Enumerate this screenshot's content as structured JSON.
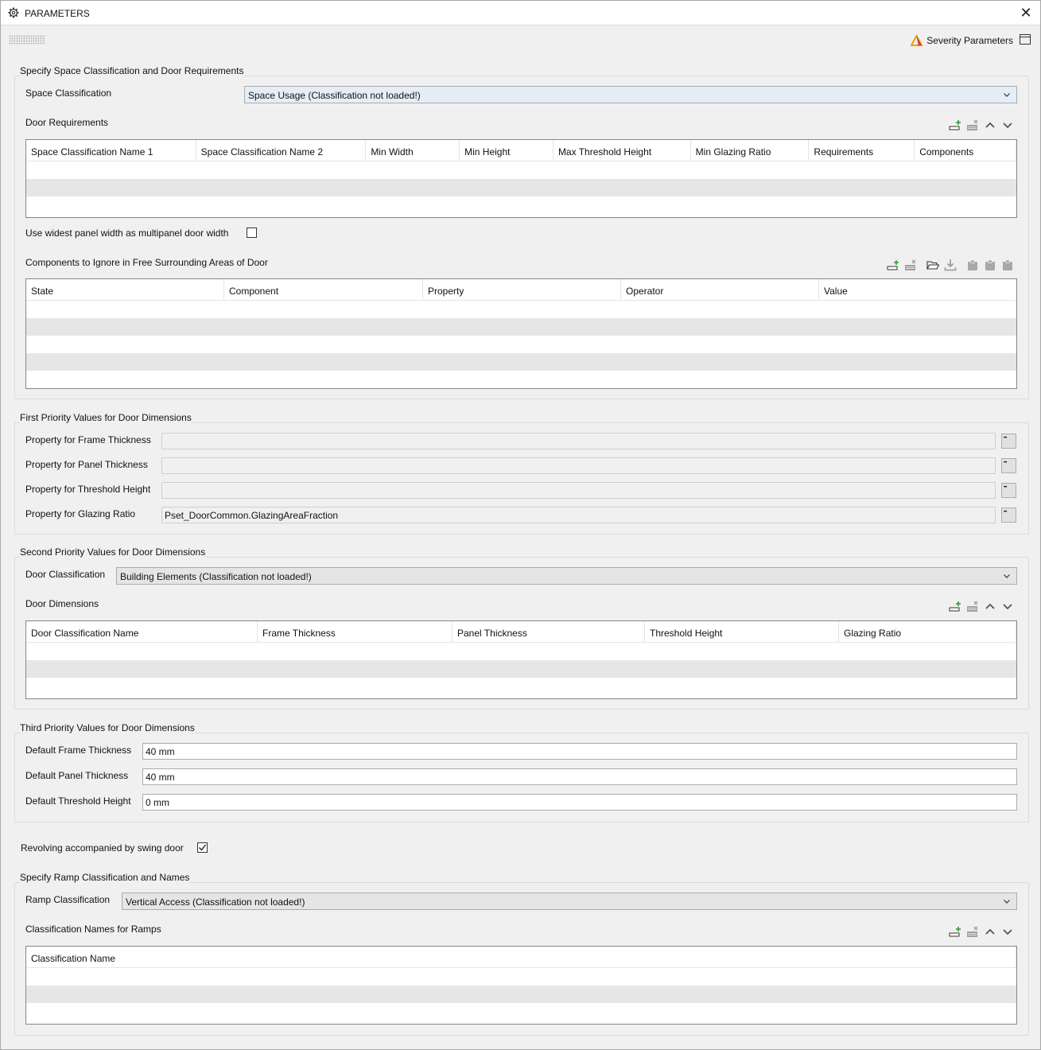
{
  "window": {
    "title": "PARAMETERS",
    "close": "✕"
  },
  "header": {
    "severity_label": "Severity Parameters"
  },
  "space": {
    "group_title": "Specify Space Classification and Door Requirements",
    "classification_label": "Space Classification",
    "classification_value": "Space Usage (Classification not loaded!)",
    "door_req_label": "Door Requirements",
    "columns": [
      "Space Classification Name 1",
      "Space Classification Name 2",
      "Min Width",
      "Min Height",
      "Max Threshold Height",
      "Min Glazing Ratio",
      "Requirements",
      "Components"
    ],
    "widest_label": "Use widest panel width as multipanel door width",
    "widest_checked": false,
    "ignore_label": "Components to Ignore in Free Surrounding Areas of Door",
    "ignore_columns": [
      "State",
      "Component",
      "Property",
      "Operator",
      "Value"
    ]
  },
  "first": {
    "group_title": "First Priority Values for Door Dimensions",
    "frame_label": "Property for Frame Thickness",
    "frame_value": "",
    "panel_label": "Property for Panel Thickness",
    "panel_value": "",
    "threshold_label": "Property for Threshold Height",
    "threshold_value": "",
    "glazing_label": "Property for Glazing Ratio",
    "glazing_value": "Pset_DoorCommon.GlazingAreaFraction"
  },
  "second": {
    "group_title": "Second Priority Values for Door Dimensions",
    "classification_label": "Door Classification",
    "classification_value": "Building Elements (Classification not loaded!)",
    "dims_label": "Door Dimensions",
    "columns": [
      "Door Classification Name",
      "Frame Thickness",
      "Panel Thickness",
      "Threshold Height",
      "Glazing Ratio"
    ]
  },
  "third": {
    "group_title": "Third Priority Values for Door Dimensions",
    "frame_label": "Default Frame Thickness",
    "frame_value": "40 mm",
    "panel_label": "Default Panel Thickness",
    "panel_value": "40 mm",
    "threshold_label": "Default Threshold Height",
    "threshold_value": "0 mm"
  },
  "revolving": {
    "label": "Revolving accompanied by swing door",
    "checked": true
  },
  "ramp": {
    "group_title": "Specify Ramp Classification and Names",
    "classification_label": "Ramp Classification",
    "classification_value": "Vertical Access (Classification not loaded!)",
    "names_label": "Classification Names for Ramps",
    "columns": [
      "Classification Name"
    ]
  },
  "icons": {
    "add": "add-row-icon",
    "remove": "remove-row-icon",
    "up": "move-up-icon",
    "down": "move-down-icon",
    "open": "open-folder-icon",
    "import": "import-icon",
    "clipboard": "clipboard-icon",
    "warning": "warning-triangle-icon"
  },
  "colors": {
    "warning": "#e8a200",
    "warning_red": "#d62b1f",
    "add_green": "#2e9e3e",
    "alt_row": "#e6e6e6",
    "combo_blue": "#e5eef7"
  }
}
